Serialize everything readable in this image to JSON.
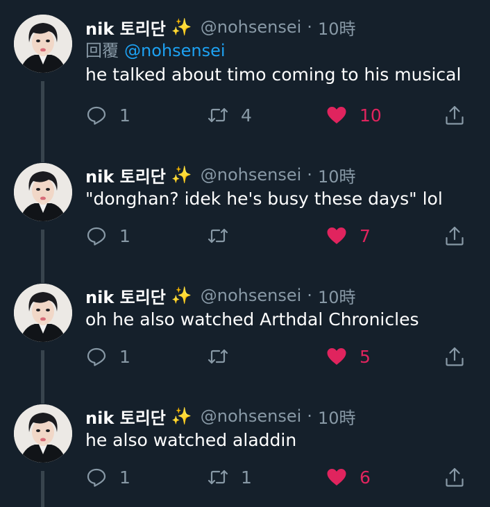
{
  "author": {
    "name": "nik 토리단",
    "sparkle": "✨",
    "handle": "@nohsensei",
    "separator": "·",
    "avatar_icon": "portrait-avatar"
  },
  "colors": {
    "background": "#15202b",
    "text": "#ffffff",
    "muted": "#8899a6",
    "link": "#1da1f2",
    "like": "#e0245e",
    "thread_line": "#38444d"
  },
  "tweets": [
    {
      "time": "10時",
      "reply_label": "回覆",
      "reply_handle": "@nohsensei",
      "text": "he talked about timo coming to his musical",
      "replies": "1",
      "retweets": "4",
      "likes": "10"
    },
    {
      "time": "10時",
      "text": "\"donghan? idek he's busy these days\" lol",
      "replies": "1",
      "retweets": "",
      "likes": "7"
    },
    {
      "time": "10時",
      "text": "oh he also watched Arthdal Chronicles",
      "replies": "1",
      "retweets": "",
      "likes": "5"
    },
    {
      "time": "10時",
      "text": "he also watched aladdin",
      "replies": "1",
      "retweets": "1",
      "likes": "6"
    }
  ]
}
